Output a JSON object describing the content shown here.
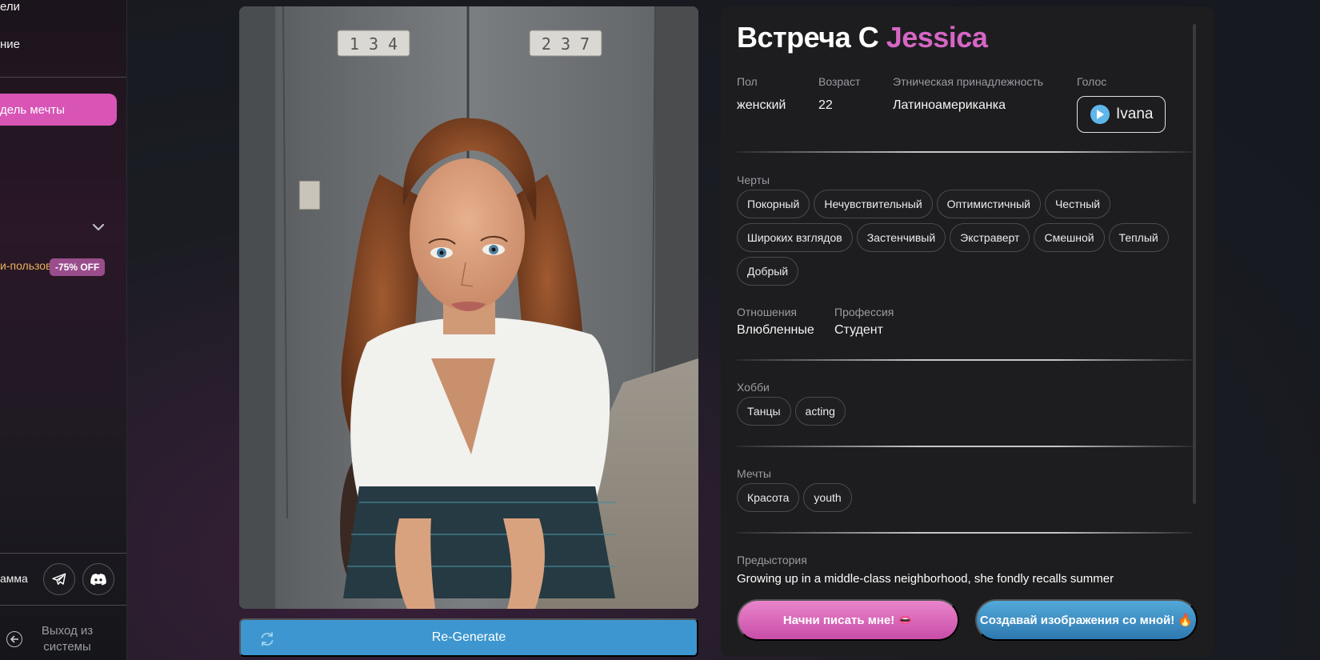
{
  "sidebar": {
    "item_top_1": "ели",
    "item_top_2": "ние",
    "active_item": "дель мечты",
    "promo_text": "и-пользова",
    "promo_badge": "-75% OFF",
    "community_label": "амма",
    "logout_label": "Выход из системы"
  },
  "photo": {
    "locker_numbers": [
      "1 3 4",
      "2 3 7"
    ]
  },
  "regenerate": {
    "label": "Re-Generate"
  },
  "profile": {
    "title_prefix": "Встреча С",
    "name": "Jessica",
    "gender_label": "Пол",
    "gender_value": "женский",
    "age_label": "Возраст",
    "age_value": "22",
    "ethnicity_label": "Этническая принадлежность",
    "ethnicity_value": "Латиноамериканка",
    "voice_label": "Голос",
    "voice_value": "Ivana",
    "traits_label": "Черты",
    "traits": [
      "Покорный",
      "Нечувствительный",
      "Оптимистичный",
      "Честный",
      "Широких взглядов",
      "Застенчивый",
      "Экстраверт",
      "Смешной",
      "Теплый",
      "Добрый"
    ],
    "relationship_label": "Отношения",
    "relationship_value": "Влюбленные",
    "profession_label": "Профессия",
    "profession_value": "Студент",
    "hobbies_label": "Хобби",
    "hobbies": [
      "Танцы",
      "acting"
    ],
    "dreams_label": "Мечты",
    "dreams": [
      "Красота",
      "youth"
    ],
    "backstory_label": "Предыстория",
    "backstory_text": "Growing up in a middle-class neighborhood, she fondly recalls summer"
  },
  "actions": {
    "chat_label": "Начни писать мне! 👄",
    "images_label": "Создавай изображения со мной! 🔥"
  },
  "colors": {
    "accent_pink": "#d855b6",
    "name_pink": "#d666c4",
    "regen_blue": "#3d96cf"
  }
}
